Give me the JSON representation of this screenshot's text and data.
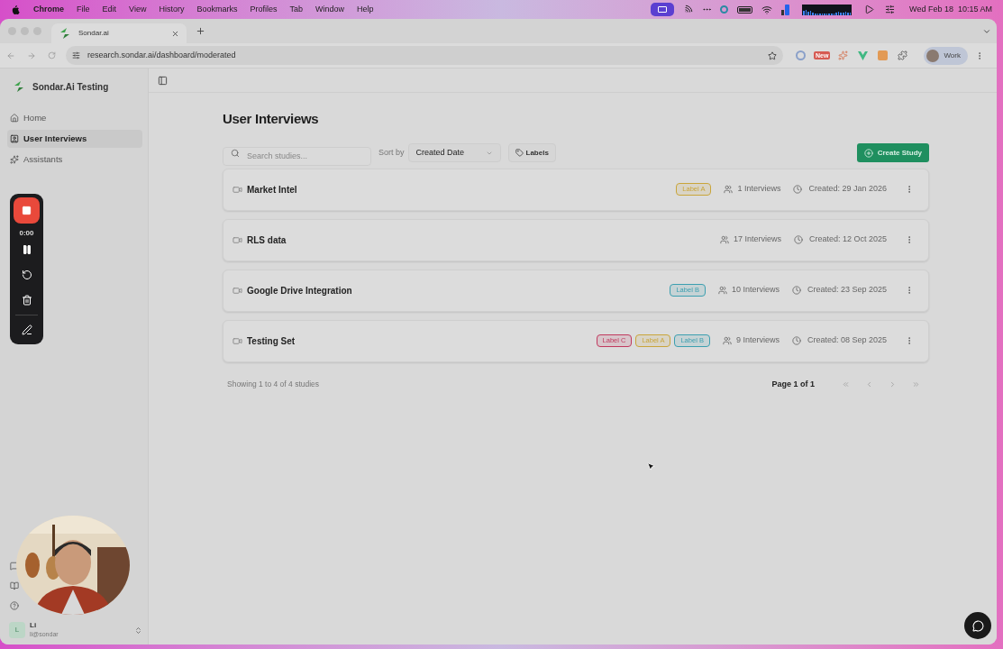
{
  "menubar": {
    "app": "Chrome",
    "menus": [
      "File",
      "Edit",
      "View",
      "History",
      "Bookmarks",
      "Profiles",
      "Tab",
      "Window",
      "Help"
    ],
    "date": "Wed Feb 18",
    "time": "10:15 AM"
  },
  "browser": {
    "tab_title": "Sondar.ai",
    "url": "research.sondar.ai/dashboard/moderated",
    "extension_badge": "New",
    "profile": "Work"
  },
  "sidebar": {
    "workspace": "Sondar.Ai Testing",
    "items": [
      {
        "label": "Home",
        "selected": false
      },
      {
        "label": "User Interviews",
        "selected": true
      },
      {
        "label": "Assistants",
        "selected": false
      }
    ],
    "user": {
      "avatar": "L",
      "name": "Li",
      "email": "li@sondar"
    }
  },
  "recorder": {
    "time": "0:00"
  },
  "main": {
    "title": "User Interviews",
    "search": {
      "placeholder": "Search studies..."
    },
    "sort_label": "Sort by",
    "sort_value": "Created Date",
    "labels_button": "Labels",
    "create_button": "Create Study",
    "studies": [
      {
        "name": "Market Intel",
        "labels": [
          {
            "text": "Label A",
            "color": "#c9a53a"
          }
        ],
        "interviews": "1 Interviews",
        "created": "Created: 29 Jan 2026"
      },
      {
        "name": "RLS data",
        "interviews": "17 Interviews",
        "created": "Created: 12 Oct 2025"
      },
      {
        "name": "Google Drive Integration",
        "labels": [
          {
            "text": "Label B",
            "color": "#3c9fb0"
          }
        ],
        "interviews": "10 Interviews",
        "created": "Created: 23 Sep 2025"
      },
      {
        "name": "Testing Set",
        "labels": [
          {
            "text": "Label C",
            "color": "#c0395e"
          },
          {
            "text": "Label A",
            "color": "#c9a53a"
          },
          {
            "text": "Label B",
            "color": "#3c9fb0"
          }
        ],
        "interviews": "9 Interviews",
        "created": "Created: 08 Sep 2025"
      }
    ],
    "showing": "Showing 1 to 4 of 4 studies",
    "page": "Page 1 of 1"
  }
}
